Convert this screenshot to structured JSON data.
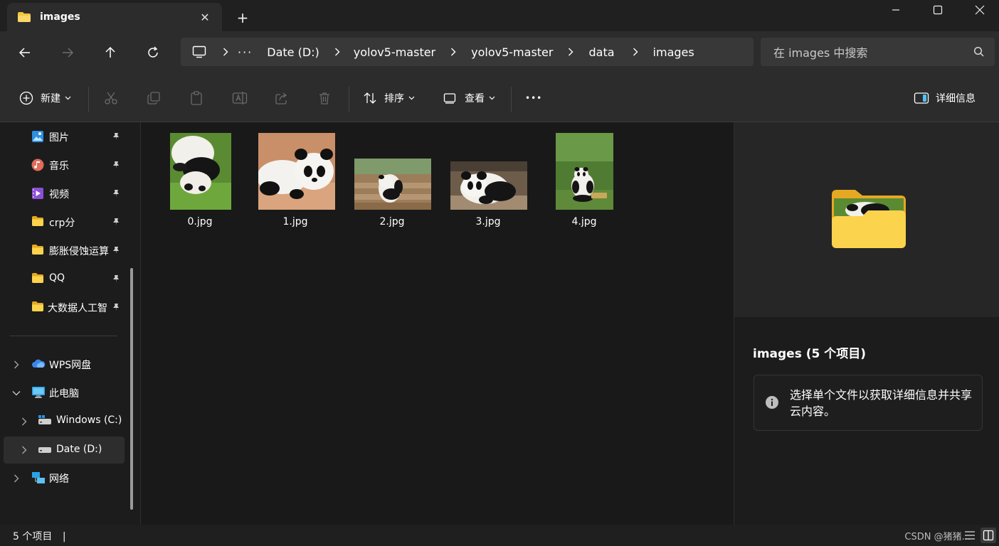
{
  "window": {
    "tab_title": "images",
    "new_tab": "+",
    "close_tab": "✕"
  },
  "breadcrumb": [
    "Date (D:)",
    "yolov5-master",
    "yolov5-master",
    "data",
    "images"
  ],
  "search": {
    "placeholder": "在 images 中搜索"
  },
  "toolbar": {
    "new_label": "新建",
    "sort_label": "排序",
    "view_label": "查看",
    "more_label": "•••",
    "details_label": "详细信息"
  },
  "sidebar": {
    "pinned": [
      {
        "label": "图片",
        "icon": "pictures-icon"
      },
      {
        "label": "音乐",
        "icon": "music-icon"
      },
      {
        "label": "视频",
        "icon": "video-icon"
      },
      {
        "label": "crp分",
        "icon": "folder-icon"
      },
      {
        "label": "膨胀侵蚀运算",
        "icon": "folder-icon"
      },
      {
        "label": "QQ",
        "icon": "folder-icon"
      },
      {
        "label": "大数据人工智",
        "icon": "folder-icon"
      }
    ],
    "tree": [
      {
        "label": "WPS网盘",
        "icon": "cloud-icon"
      },
      {
        "label": "此电脑",
        "icon": "computer-icon"
      },
      {
        "label": "Windows (C:)",
        "icon": "drive-icon"
      },
      {
        "label": "Date (D:)",
        "icon": "drive-icon"
      },
      {
        "label": "网络",
        "icon": "network-icon"
      }
    ]
  },
  "files": [
    {
      "name": "0.jpg"
    },
    {
      "name": "1.jpg"
    },
    {
      "name": "2.jpg"
    },
    {
      "name": "3.jpg"
    },
    {
      "name": "4.jpg"
    }
  ],
  "details": {
    "title": "images (5 个项目)",
    "info": "选择单个文件以获取详细信息并共享云内容。"
  },
  "status": {
    "count": "5 个项目",
    "divider": "|",
    "watermark": "CSDN @猪猪..."
  },
  "colors": {
    "accent": "#4cc2ff",
    "folder": "#f8c63d",
    "folder_dark": "#e6a823",
    "grass": "#5d8a3a"
  }
}
